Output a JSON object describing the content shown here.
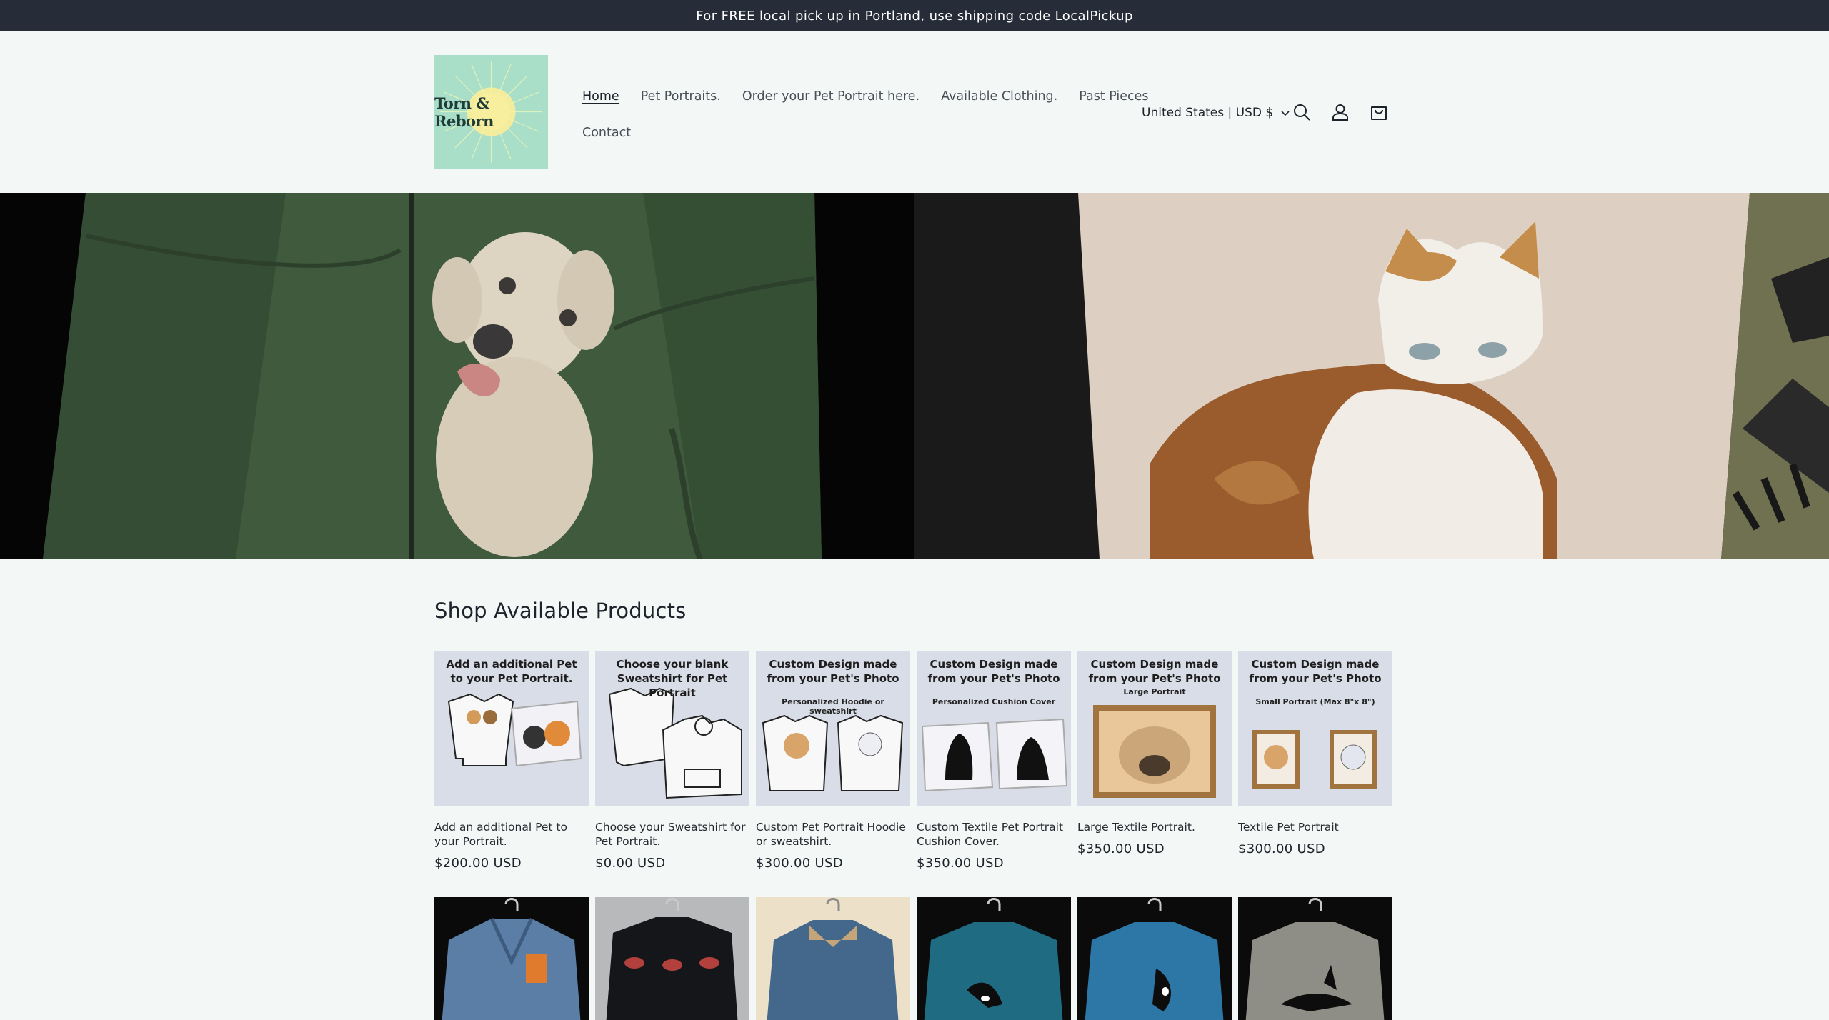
{
  "announcement": {
    "text": "For FREE local pick up in Portland, use shipping code LocalPickup"
  },
  "header": {
    "logo_text": "Torn & Reborn",
    "nav_row1": [
      {
        "label": "Home",
        "active": true
      },
      {
        "label": "Pet Portraits.",
        "active": false
      },
      {
        "label": "Order your Pet Portrait here.",
        "active": false
      },
      {
        "label": "Available Clothing.",
        "active": false
      },
      {
        "label": "Past Pieces",
        "active": false
      }
    ],
    "nav_row2": [
      {
        "label": "Contact",
        "active": false
      }
    ],
    "country_selector": "United States | USD $",
    "icons": [
      "search-icon",
      "account-icon",
      "cart-icon"
    ]
  },
  "hero": {
    "left_image": "embroidered-dog-on-green-hoodie",
    "right_image": "textile-cat-on-cushion"
  },
  "products_section": {
    "title": "Shop Available Products",
    "products": [
      {
        "image_heading": "Add an additional Pet to your Pet Portrait.",
        "image_sub": "",
        "title": "Add an additional Pet to your Portrait.",
        "price": "$200.00 USD"
      },
      {
        "image_heading": "Choose your blank Sweatshirt for Pet Portrait",
        "image_sub": "",
        "title": "Choose your Sweatshirt for Pet Portrait.",
        "price": "$0.00 USD"
      },
      {
        "image_heading": "Custom Design made from your Pet's Photo",
        "image_sub": "Personalized Hoodie or sweatshirt",
        "title": "Custom Pet Portrait Hoodie or sweatshirt.",
        "price": "$300.00 USD"
      },
      {
        "image_heading": "Custom Design made from your Pet's Photo",
        "image_sub": "Personalized Cushion Cover",
        "title": "Custom Textile Pet Portrait Cushion Cover.",
        "price": "$350.00 USD"
      },
      {
        "image_heading": "Custom Design made from your Pet's Photo",
        "image_sub": "Large Portrait",
        "title": "Large Textile Portrait.",
        "price": "$350.00 USD"
      },
      {
        "image_heading": "Custom Design made from your Pet's Photo",
        "image_sub": "Small Portrait (Max 8\"x 8\")",
        "title": "Textile Pet Portrait",
        "price": "$300.00 USD"
      }
    ],
    "second_row_images": [
      "denim-jacket-with-fox",
      "black-sweater-with-eyes",
      "denim-jacket-tan-collar",
      "teal-sweater-orca",
      "blue-sweater-orca",
      "grey-sweater-orca"
    ]
  },
  "colors": {
    "announcement_bg": "#262c38",
    "page_bg": "#f3f7f6",
    "logo_bg": "#a9dec9",
    "card_bg": "#d9dde7"
  }
}
